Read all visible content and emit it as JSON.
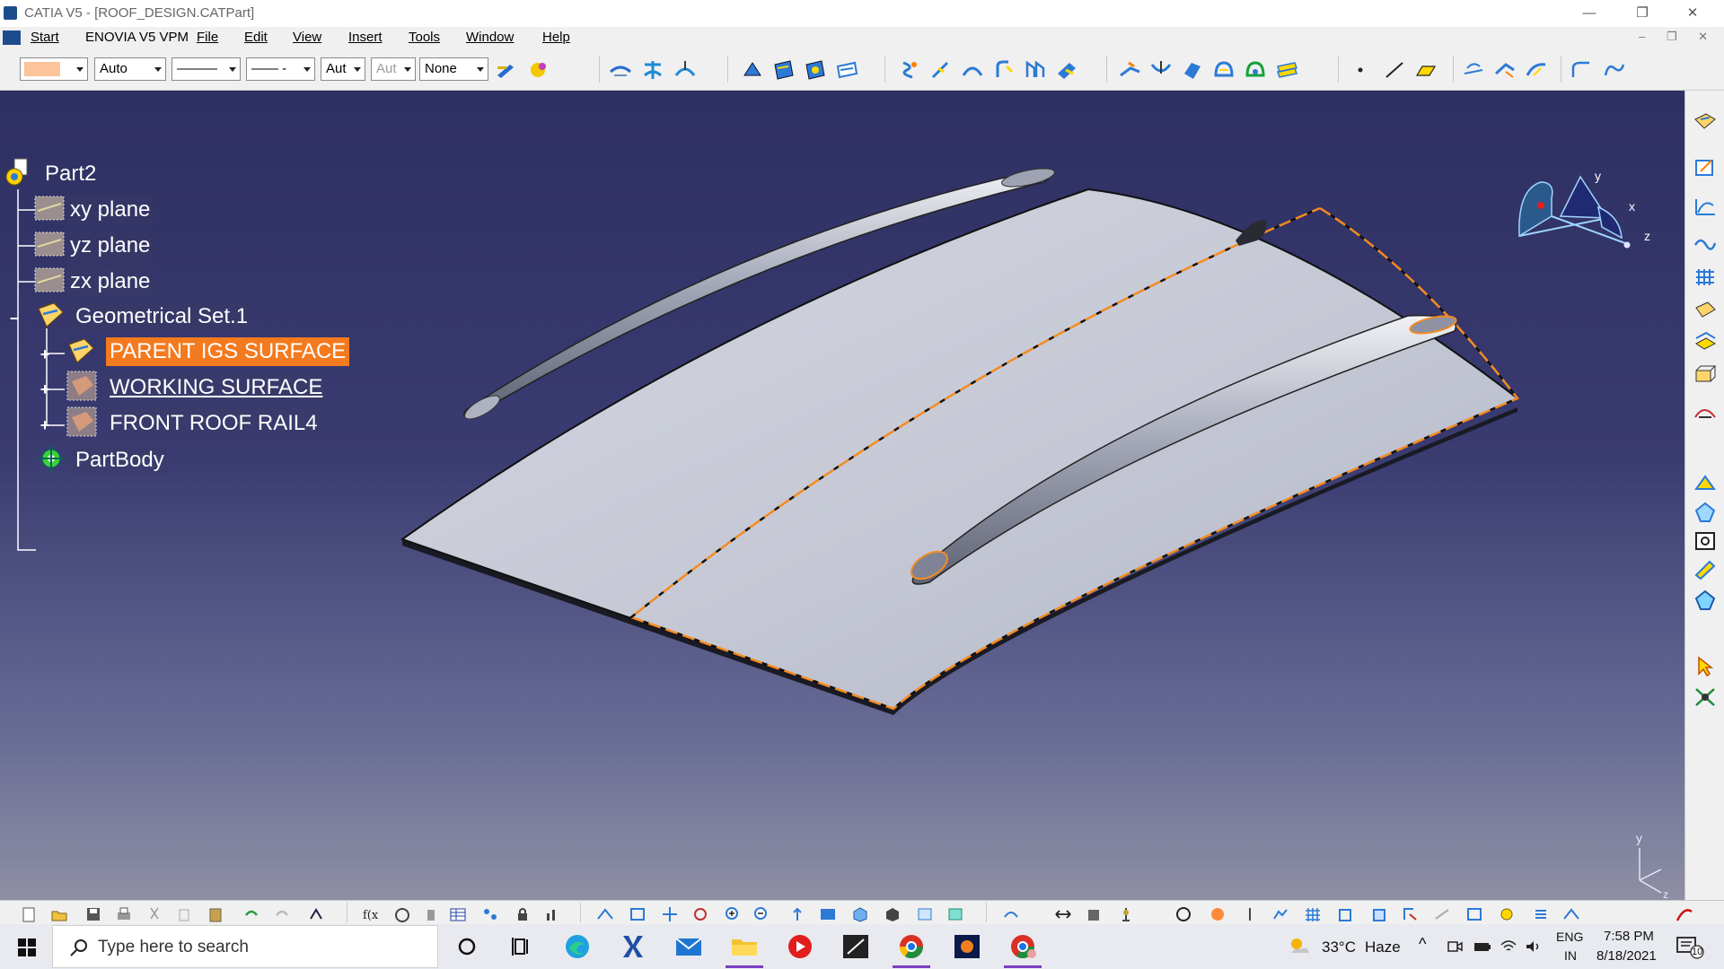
{
  "window": {
    "title": "CATIA V5 - [ROOF_DESIGN.CATPart]",
    "minimize": "—",
    "restore": "❐",
    "close": "✕"
  },
  "menu": {
    "items": [
      {
        "label": "Start"
      },
      {
        "label": "ENOVIA V5 VPM"
      },
      {
        "label": "File"
      },
      {
        "label": "Edit"
      },
      {
        "label": "View"
      },
      {
        "label": "Insert"
      },
      {
        "label": "Tools"
      },
      {
        "label": "Window"
      },
      {
        "label": "Help"
      }
    ],
    "mdi_controls": "– ❐ ✕"
  },
  "toolbar": {
    "color_combo": "",
    "transparency_combo": "Auto",
    "line_thickness_combo": "———",
    "line_type_combo": "—— -",
    "point_type_combo": "Aut",
    "layer_combo_disabled": "Aut",
    "layer_combo": "None"
  },
  "tree": {
    "root": "Part2",
    "planes": [
      "xy plane",
      "yz plane",
      "zx plane"
    ],
    "geometrical_set": "Geometrical Set.1",
    "children": [
      "PARENT IGS SURFACE",
      "WORKING SURFACE",
      "FRONT ROOF RAIL4"
    ],
    "body": "PartBody"
  },
  "compass": {
    "x": "x",
    "y": "y",
    "z": "z"
  },
  "axis_triad": {
    "y": "y",
    "z": "z"
  },
  "colors": {
    "viewport_top": "#2e2f62",
    "viewport_bottom": "#8e8fa5",
    "selection": "#f37a1e",
    "surface": "#c8cbd6"
  },
  "taskbar": {
    "search_placeholder": "Type here to search",
    "weather_temp": "33°C",
    "weather_text": "Haze",
    "lang_top": "ENG",
    "lang_bottom": "IN",
    "time": "7:58 PM",
    "date": "8/18/2021",
    "notifications": "10"
  }
}
